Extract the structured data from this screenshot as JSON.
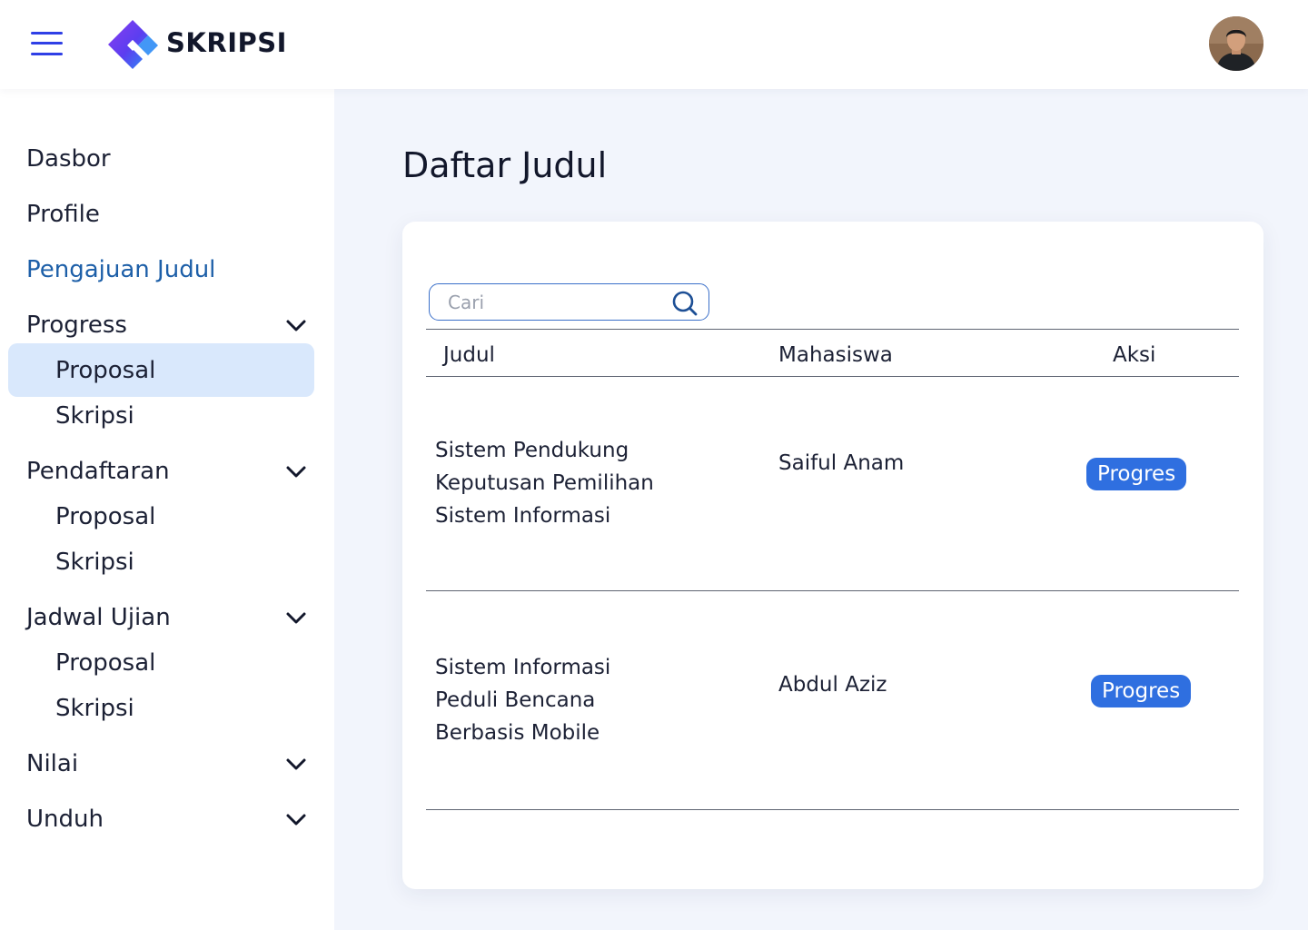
{
  "header": {
    "brand": "SKRIPSI",
    "colors": {
      "logo_primary": "#6a3df0",
      "logo_secondary": "#2f8cf5",
      "menu_icon": "#2f3fe6"
    }
  },
  "sidebar": {
    "items": [
      {
        "label": "Dasbor"
      },
      {
        "label": "Profile"
      },
      {
        "label": "Pengajuan Judul",
        "active": true
      },
      {
        "label": "Progress",
        "expandable": true,
        "children": [
          "Proposal",
          "Skripsi"
        ],
        "selected_child": "Proposal"
      },
      {
        "label": "Pendaftaran",
        "expandable": true,
        "children": [
          "Proposal",
          "Skripsi"
        ]
      },
      {
        "label": "Jadwal Ujian",
        "expandable": true,
        "children": [
          "Proposal",
          "Skripsi"
        ]
      },
      {
        "label": "Nilai",
        "expandable": true
      },
      {
        "label": "Unduh",
        "expandable": true
      }
    ],
    "colors": {
      "active_text": "#1d5fa8",
      "selected_bg": "#d9e8fc"
    }
  },
  "main": {
    "title": "Daftar Judul",
    "search": {
      "placeholder": "Cari",
      "value": ""
    },
    "table": {
      "columns": [
        "Judul",
        "Mahasiswa",
        "Aksi"
      ],
      "rows": [
        {
          "judul": [
            "Sistem Pendukung",
            "Keputusan Pemilihan",
            "Sistem Informasi"
          ],
          "mahasiswa": "Saiful Anam",
          "aksi": "Progres"
        },
        {
          "judul": [
            "Sistem Informasi",
            "Peduli Bencana",
            "Berbasis Mobile"
          ],
          "mahasiswa": "Abdul Aziz",
          "aksi": "Progres"
        }
      ]
    },
    "colors": {
      "action_button": "#2f6fe0"
    }
  }
}
